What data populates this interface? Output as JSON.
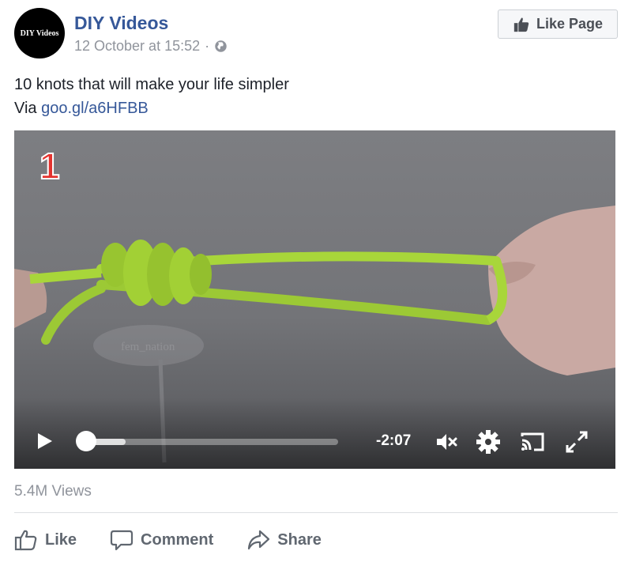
{
  "post": {
    "avatar_text": "DIY Videos",
    "page_name": "DIY Videos",
    "timestamp": "12 October at 15:52",
    "separator": "·",
    "privacy_icon": "globe-icon",
    "like_page_label": "Like Page",
    "text_line1": "10 knots that will make your life simpler",
    "text_via": "Via",
    "link": "goo.gl/a6HFBB"
  },
  "video": {
    "overlay_number": "1",
    "watermark_text": "fem_nation",
    "time_remaining": "-2:07",
    "progress_fraction": 0.16,
    "icons": [
      "play-icon",
      "mute-icon",
      "settings-gear-icon",
      "cast-icon",
      "fullscreen-icon"
    ]
  },
  "stats": {
    "views": "5.4M Views"
  },
  "actions": {
    "like": "Like",
    "comment": "Comment",
    "share": "Share"
  },
  "colors": {
    "link": "#365899",
    "muted": "#90949c",
    "rope": "#a8d63a"
  }
}
